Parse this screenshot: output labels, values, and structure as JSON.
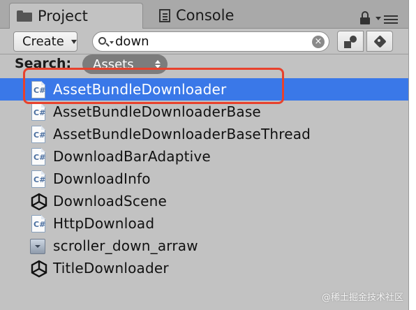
{
  "tabs": {
    "project": "Project",
    "console": "Console"
  },
  "toolbar": {
    "create_label": "Create",
    "search_value": "down",
    "clear_glyph": "×"
  },
  "scope": {
    "label": "Search:",
    "value": "Assets"
  },
  "list": {
    "items": [
      {
        "label": "AssetBundleDownloader",
        "icon": "csharp-script-icon",
        "selected": true
      },
      {
        "label": "AssetBundleDownloaderBase",
        "icon": "csharp-script-icon"
      },
      {
        "label": "AssetBundleDownloaderBaseThread",
        "icon": "csharp-script-icon"
      },
      {
        "label": "DownloadBarAdaptive",
        "icon": "csharp-script-icon"
      },
      {
        "label": "DownloadInfo",
        "icon": "csharp-script-icon"
      },
      {
        "label": "DownloadScene",
        "icon": "unity-scene-icon"
      },
      {
        "label": "HttpDownload",
        "icon": "csharp-script-icon"
      },
      {
        "label": "scroller_down_arraw",
        "icon": "texture-icon"
      },
      {
        "label": "TitleDownloader",
        "icon": "unity-scene-icon"
      }
    ]
  },
  "watermark": "@稀土掘金技术社区",
  "colors": {
    "selection": "#3a78e8",
    "highlight_box": "#e8412c",
    "panel_bg": "#c2c2c2"
  }
}
